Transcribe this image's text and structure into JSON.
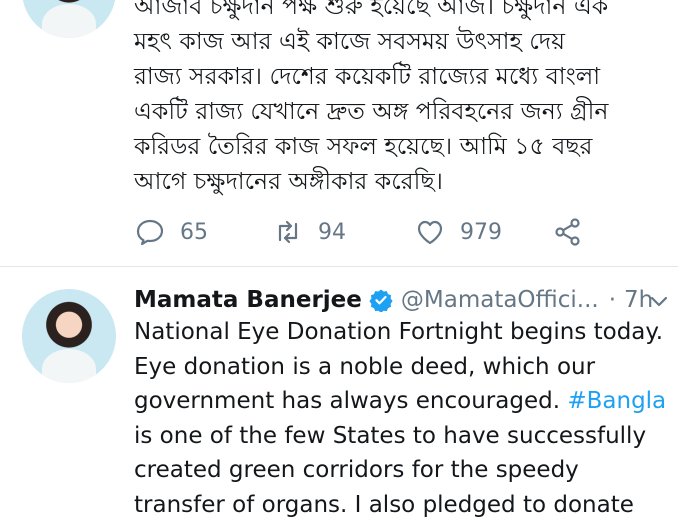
{
  "tweet1": {
    "lines": [
      "আজাব চক্ষুদান পক্ষ শুরু হয়েছে আজ। চক্ষুদান এক",
      "মহৎ কাজ আর এই কাজে সবসময় উৎসাহ দেয়",
      "রাজ্য সরকার। দেশের কয়েকটি রাজ্যের মধ্যে বাংলা",
      "একটি রাজ্য যেখানে দ্রুত অঙ্গ পরিবহনের জন্য গ্রীন",
      "করিডর তৈরির কাজ সফল হয়েছে। আমি ১৫ বছর",
      "আগে চক্ষুদানের অঙ্গীকার করেছি।"
    ],
    "replies": "65",
    "retweets": "94",
    "likes": "979"
  },
  "tweet2": {
    "name": "Mamata Banerjee",
    "handle": "@MamataOffici...",
    "separator": "·",
    "time": "7h",
    "line1": "National Eye Donation Fortnight begins today.",
    "line2": "Eye donation is a noble deed, which our",
    "line3_pre": "government has always encouraged.",
    "hashtag": "#Bangla",
    "line4": "is one of the few States to have successfully",
    "line5": "created green corridors for the speedy",
    "line6": "transfer of organs. I also pledged to donate"
  },
  "colors": {
    "link": "#1da1f2",
    "muted": "#657786",
    "text": "#14171a",
    "verified": "#1da1f2"
  },
  "icons": [
    "reply-icon",
    "retweet-icon",
    "like-icon",
    "share-icon",
    "verified-badge-icon",
    "chevron-down-icon"
  ]
}
